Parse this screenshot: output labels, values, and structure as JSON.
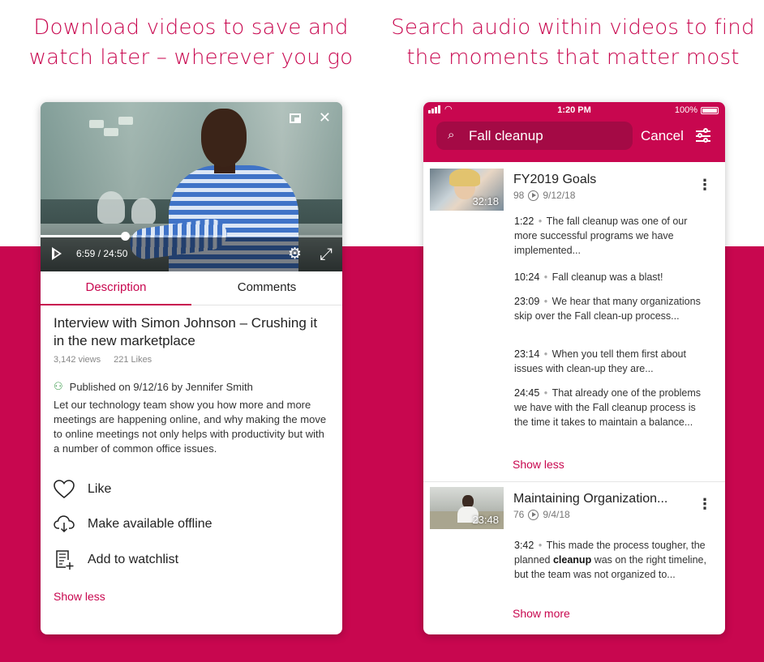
{
  "headlines": {
    "left": "Download videos to save and watch later – wherever you go",
    "right": "Search audio within videos to find the moments that matter most"
  },
  "colors": {
    "accent": "#c8074f",
    "accent_dark": "#a40a45",
    "background": "#ffffff"
  },
  "player": {
    "time": "6:59 / 24:50",
    "progress": 0.28,
    "icons": [
      "picture-in-picture-icon",
      "close-icon",
      "play-icon",
      "settings-icon",
      "fullscreen-icon"
    ]
  },
  "tabs": [
    {
      "label": "Description",
      "active": true
    },
    {
      "label": "Comments",
      "active": false
    }
  ],
  "video": {
    "title": "Interview with Simon Johnson – Crushing it in the new marketplace",
    "views": "3,142 views",
    "likes": "221 Likes",
    "published": "Published on 9/12/16 by Jennifer Smith",
    "description": "Let our technology team show you how more and more meetings are happening online, and why making the move to online meetings not only helps with productivity but with a number of common office issues."
  },
  "actions": [
    {
      "label": "Like",
      "icon": "heart-icon"
    },
    {
      "label": "Make available offline",
      "icon": "cloud-download-icon"
    },
    {
      "label": "Add to watchlist",
      "icon": "watchlist-add-icon"
    }
  ],
  "left_show_less": "Show less",
  "status_bar": {
    "time": "1:20 PM",
    "battery": "100%"
  },
  "search": {
    "query": "Fall cleanup",
    "cancel": "Cancel"
  },
  "results": [
    {
      "title": "FY2019 Goals",
      "views": "98",
      "date": "9/12/18",
      "duration": "32:18",
      "snippets": [
        {
          "ts": "1:22",
          "parts": [
            [
              "The ",
              false
            ],
            [
              "fall cleanup",
              false
            ],
            [
              " was one of our more successful programs we have implemented...",
              false
            ]
          ]
        },
        {
          "ts": "10:24",
          "parts": [
            [
              "Fall cleanup",
              false
            ],
            [
              " was a blast!",
              false
            ]
          ]
        },
        {
          "ts": "23:09",
          "parts": [
            [
              "We hear that many organizations skip over the Fall clean-up process...",
              false
            ]
          ]
        },
        {
          "ts": "23:14",
          "parts": [
            [
              "When you tell them first about issues with clean-up they are...",
              false
            ]
          ]
        },
        {
          "ts": "24:45",
          "parts": [
            [
              "That already one of the problems we have with the Fall cleanup process is the time it takes to maintain a balance...",
              false
            ]
          ]
        }
      ],
      "toggle": "Show less"
    },
    {
      "title": "Maintaining Organization...",
      "views": "76",
      "date": "9/4/18",
      "duration": "23:48",
      "snippets": [
        {
          "ts": "3:42",
          "parts": [
            [
              "This made the process tougher, the planned ",
              false
            ],
            [
              "cleanup",
              true
            ],
            [
              " was on the right timeline, but the team was not organized to...",
              false
            ]
          ]
        }
      ],
      "toggle": "Show more"
    }
  ]
}
